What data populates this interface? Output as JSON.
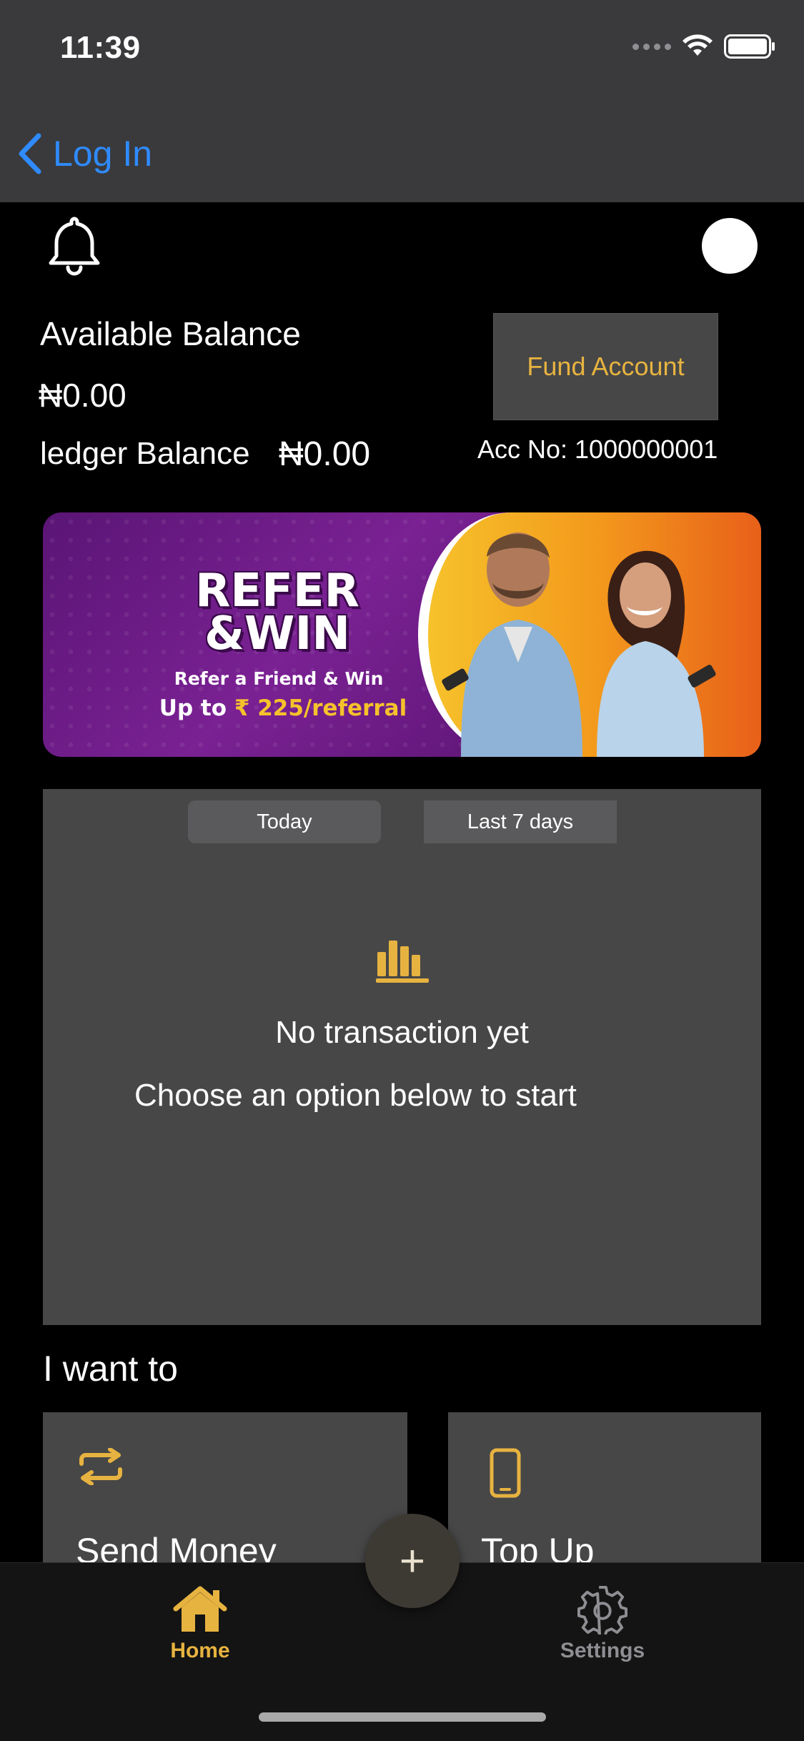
{
  "status_bar": {
    "time": "11:39"
  },
  "nav": {
    "back_label": "Log In"
  },
  "balance": {
    "available_label": "Available Balance",
    "available_amount": "₦0.00",
    "ledger_label": "ledger Balance",
    "ledger_amount": "₦0.00",
    "fund_button": "Fund Account",
    "account_number": "Acc No: 1000000001"
  },
  "banner": {
    "title_line1": "REFER",
    "title_line2": "&WIN",
    "subtitle": "Refer a Friend & Win",
    "offer_prefix": "Up to ",
    "offer_highlight": "₹ 225/referral"
  },
  "transactions": {
    "tabs": [
      "Today",
      "Last 7 days"
    ],
    "empty_title": "No transaction yet",
    "empty_subtitle": "Choose an option below to start"
  },
  "actions": {
    "heading": "I want to",
    "items": [
      {
        "label": "Send Money",
        "icon": "transfer-arrows-icon"
      },
      {
        "label": "Top Up",
        "icon": "mobile-phone-icon"
      }
    ]
  },
  "fab_symbol": "+",
  "tab_bar": {
    "items": [
      {
        "label": "Home",
        "icon": "home-icon",
        "active": true
      },
      {
        "label": "Settings",
        "icon": "gear-icon",
        "active": false
      }
    ]
  },
  "colors": {
    "accent": "#e7b340",
    "link": "#2f8bff",
    "panel": "#474747",
    "header": "#3a3a3c"
  }
}
